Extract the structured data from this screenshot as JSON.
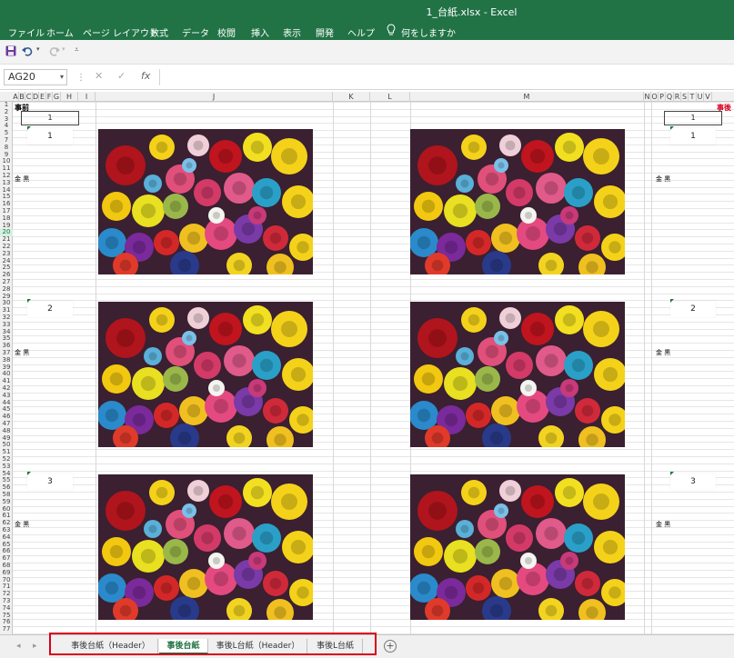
{
  "window": {
    "title": "1_台紙.xlsx  -  Excel"
  },
  "ribbon": {
    "tabs": [
      "ファイル",
      "ホーム",
      "ページ レイアウト",
      "数式",
      "データ",
      "校閲",
      "挿入",
      "表示",
      "開発",
      "ヘルプ"
    ],
    "tell_me": "何をしますか"
  },
  "qat": {
    "save_icon": "save-icon",
    "undo_icon": "undo-icon",
    "redo_icon": "redo-icon",
    "customize_icon": "customize-icon"
  },
  "formula_bar": {
    "name_box": "AG20",
    "cancel": "✕",
    "enter": "✓",
    "fx": "fx",
    "value": ""
  },
  "columns": [
    "A",
    "B",
    "C",
    "D",
    "E",
    "F",
    "G",
    "H",
    "I",
    "J",
    "K",
    "L",
    "M",
    "N",
    "O",
    "P",
    "Q",
    "R",
    "S",
    "T",
    "U",
    "V"
  ],
  "rows": [
    "1",
    "2",
    "3",
    "4",
    "5",
    "7",
    "8",
    "9",
    "10",
    "11",
    "12",
    "13",
    "14",
    "15",
    "16",
    "17",
    "18",
    "19",
    "20",
    "21",
    "22",
    "23",
    "24",
    "25",
    "26",
    "27",
    "28",
    "29",
    "30",
    "31",
    "32",
    "33",
    "34",
    "35",
    "36",
    "37",
    "38",
    "39",
    "40",
    "41",
    "42",
    "43",
    "44",
    "45",
    "46",
    "47",
    "48",
    "49",
    "50",
    "51",
    "52",
    "53",
    "54",
    "55",
    "56",
    "58",
    "59",
    "60",
    "61",
    "62",
    "63",
    "64",
    "65",
    "66",
    "67",
    "68",
    "69",
    "70",
    "71",
    "72",
    "73",
    "74",
    "75",
    "76",
    "77"
  ],
  "sheet": {
    "left_label": "事前",
    "right_label": "事後",
    "left_box": "1",
    "right_box": "1",
    "metal_label": "金 黒",
    "sections": [
      "1",
      "2",
      "3"
    ]
  },
  "sheet_tabs": {
    "tabs": [
      "事後台紙（Header）",
      "事後台紙",
      "事後L台紙（Header）",
      "事後L台紙"
    ],
    "active": "事後台紙",
    "add_icon": "add-sheet-icon"
  },
  "colors": {
    "excel_green": "#217346",
    "highlight_red": "#d9001b"
  }
}
